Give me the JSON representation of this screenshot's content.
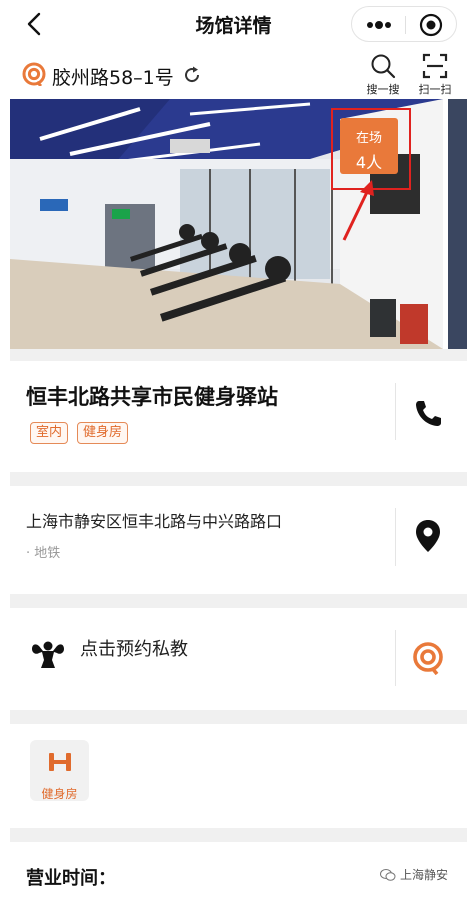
{
  "nav": {
    "title": "场馆详情"
  },
  "location": {
    "text": "胶州路58–1号"
  },
  "tools": {
    "search_label": "搜一搜",
    "scan_label": "扫一扫"
  },
  "photo": {
    "badge_line1": "在场",
    "badge_line2": "4人"
  },
  "venue": {
    "name": "恒丰北路共享市民健身驿站",
    "tags": [
      "室内",
      "健身房"
    ]
  },
  "address": {
    "text": "上海市静安区恒丰北路与中兴路路口",
    "transit": "· 地铁"
  },
  "coach": {
    "text": "点击预约私教"
  },
  "facilities": [
    {
      "label": "健身房"
    }
  ],
  "hours": {
    "title": "营业时间："
  },
  "watermark": {
    "text": "上海静安"
  },
  "colors": {
    "accent": "#e9793a",
    "highlight": "#e0221f",
    "tag_text": "#e06b2d"
  },
  "icons": {
    "back": "chevron-left-icon",
    "more": "more-dots-icon",
    "close": "target-circle-icon",
    "logo": "brand-swirl-icon",
    "refresh": "refresh-icon",
    "search": "search-icon",
    "scan": "scan-icon",
    "phone": "phone-icon",
    "pin": "location-pin-icon",
    "coach": "muscle-icon",
    "dumbbell": "dumbbell-icon"
  }
}
